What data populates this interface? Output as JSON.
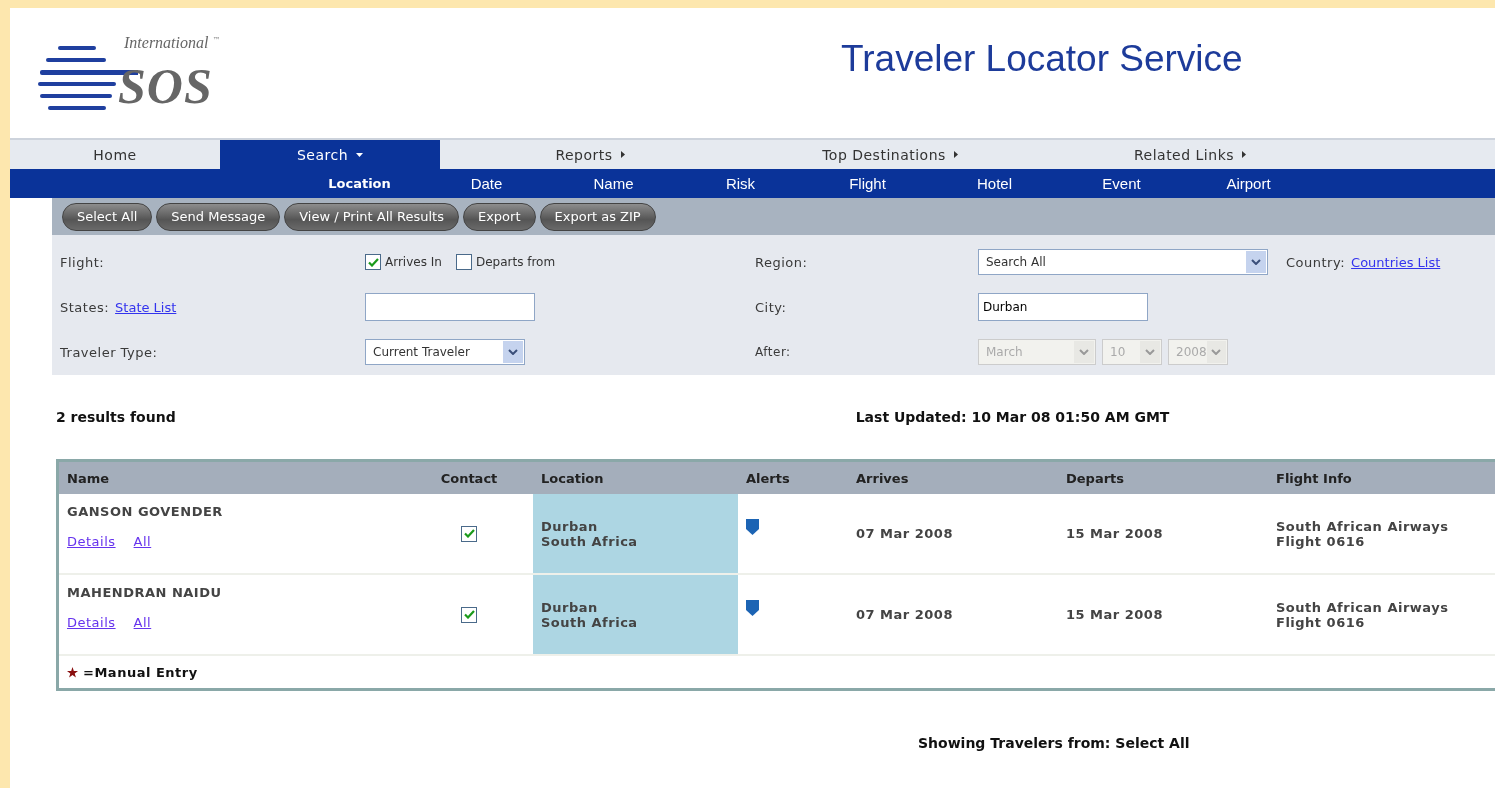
{
  "logo": {
    "top": "International",
    "main": "SOS",
    "mark": "™"
  },
  "title": "Traveler Locator Service",
  "nav": [
    {
      "label": "Home",
      "selected": false,
      "kind": "link"
    },
    {
      "label": "Search",
      "selected": true,
      "kind": "dropdown"
    },
    {
      "label": "Reports",
      "selected": false,
      "kind": "submenu"
    },
    {
      "label": "Top Destinations",
      "selected": false,
      "kind": "submenu"
    },
    {
      "label": "Related Links",
      "selected": false,
      "kind": "submenu"
    }
  ],
  "subnav": [
    {
      "label": "Location",
      "selected": true
    },
    {
      "label": "Date",
      "selected": false
    },
    {
      "label": "Name",
      "selected": false
    },
    {
      "label": "Risk",
      "selected": false
    },
    {
      "label": "Flight",
      "selected": false
    },
    {
      "label": "Hotel",
      "selected": false
    },
    {
      "label": "Event",
      "selected": false
    },
    {
      "label": "Airport",
      "selected": false
    }
  ],
  "toolbar": [
    "Select All",
    "Send Message",
    "View / Print All Results",
    "Export",
    "Export as ZIP"
  ],
  "form": {
    "flight_label": "Flight:",
    "flight_options": [
      {
        "label": "Arrives In",
        "checked": true
      },
      {
        "label": "Departs from",
        "checked": false
      }
    ],
    "region_label": "Region:",
    "region_value": "Search All",
    "country_label": "Country:",
    "country_link": "Countries List",
    "states_label": "States:",
    "states_link": "State List",
    "city_label": "City:",
    "city_value": "Durban",
    "traveler_type_label": "Traveler Type:",
    "traveler_type_value": "Current Traveler",
    "after_label": "After:",
    "after_selects": [
      {
        "value": "March",
        "disabled": true
      },
      {
        "value": "10",
        "disabled": true
      },
      {
        "value": "2008",
        "disabled": true
      }
    ]
  },
  "results_count": "2 results found",
  "last_updated": "Last Updated: 10 Mar 08 01:50 AM  GMT",
  "table": {
    "columns": [
      "Name",
      "Contact",
      "Location",
      "Alerts",
      "Arrives",
      "Departs",
      "Flight Info"
    ],
    "rows": [
      {
        "name": "GANSON GOVENDER",
        "links": [
          "Details",
          "All"
        ],
        "contact": true,
        "location": [
          "Durban",
          "South Africa"
        ],
        "arrives": "07 Mar 2008",
        "departs": "15 Mar 2008",
        "flight": [
          "South African Airways",
          "Flight 0616"
        ]
      },
      {
        "name": "MAHENDRAN NAIDU",
        "links": [
          "Details",
          "All"
        ],
        "contact": true,
        "location": [
          "Durban",
          "South Africa"
        ],
        "arrives": "07 Mar 2008",
        "departs": "15 Mar 2008",
        "flight": [
          "South African Airways",
          "Flight 0616"
        ]
      }
    ],
    "legend": "=Manual Entry"
  },
  "footer": "Showing Travelers from: Select All"
}
